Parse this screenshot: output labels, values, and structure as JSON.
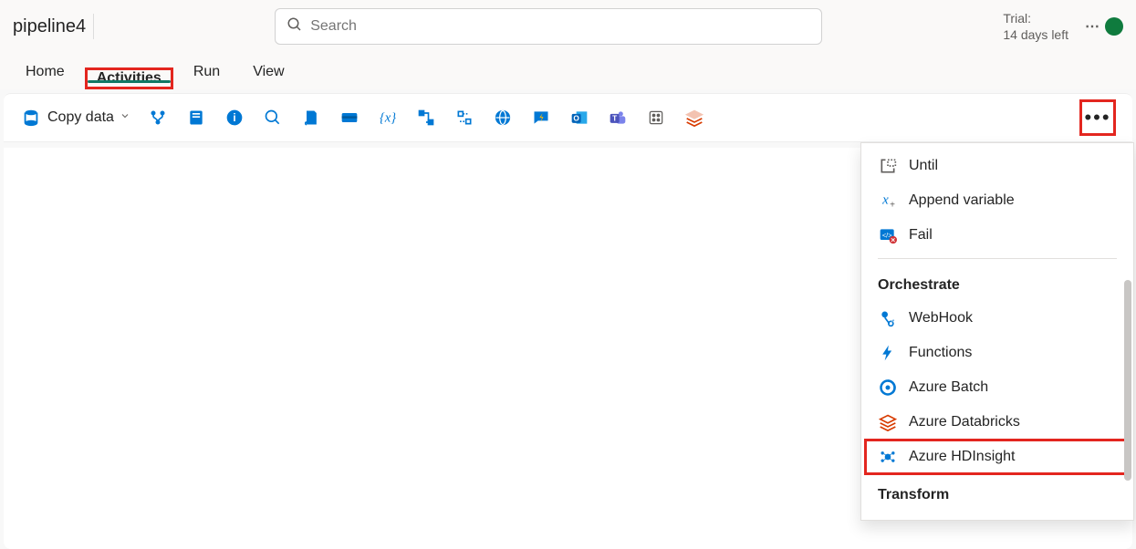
{
  "header": {
    "pipeline_name": "pipeline4",
    "search_placeholder": "Search",
    "trial_line1": "Trial:",
    "trial_line2": "14 days left"
  },
  "tabs": {
    "home": "Home",
    "activities": "Activities",
    "run": "Run",
    "view": "View",
    "active": "activities"
  },
  "toolbar": {
    "copy_data_label": "Copy data",
    "icons": [
      "copy-data-icon",
      "branch-icon",
      "notebook-icon",
      "info-icon",
      "search-icon",
      "script-icon",
      "card-icon",
      "variable-icon",
      "pipeline-icon",
      "bracket-icon",
      "globe-icon",
      "comment-flash-icon",
      "outlook-icon",
      "teams-icon",
      "dice-icon",
      "stack-icon"
    ],
    "more_label": "…"
  },
  "panel": {
    "top_items": [
      {
        "key": "until",
        "label": "Until",
        "icon": "until-icon"
      },
      {
        "key": "append-variable",
        "label": "Append variable",
        "icon": "append-variable-icon"
      },
      {
        "key": "fail",
        "label": "Fail",
        "icon": "fail-icon"
      }
    ],
    "sections": [
      {
        "title": "Orchestrate",
        "items": [
          {
            "key": "webhook",
            "label": "WebHook",
            "icon": "webhook-icon"
          },
          {
            "key": "functions",
            "label": "Functions",
            "icon": "functions-icon"
          },
          {
            "key": "azure-batch",
            "label": "Azure Batch",
            "icon": "azure-batch-icon"
          },
          {
            "key": "azure-databricks",
            "label": "Azure Databricks",
            "icon": "azure-databricks-icon"
          },
          {
            "key": "azure-hdinsight",
            "label": "Azure HDInsight",
            "icon": "azure-hdinsight-icon",
            "highlighted": true
          }
        ]
      },
      {
        "title": "Transform",
        "items": []
      }
    ]
  },
  "colors": {
    "highlight_red": "#e3261f",
    "accent_teal": "#117865",
    "icon_blue": "#0078d4",
    "icon_orange": "#d83b01"
  }
}
